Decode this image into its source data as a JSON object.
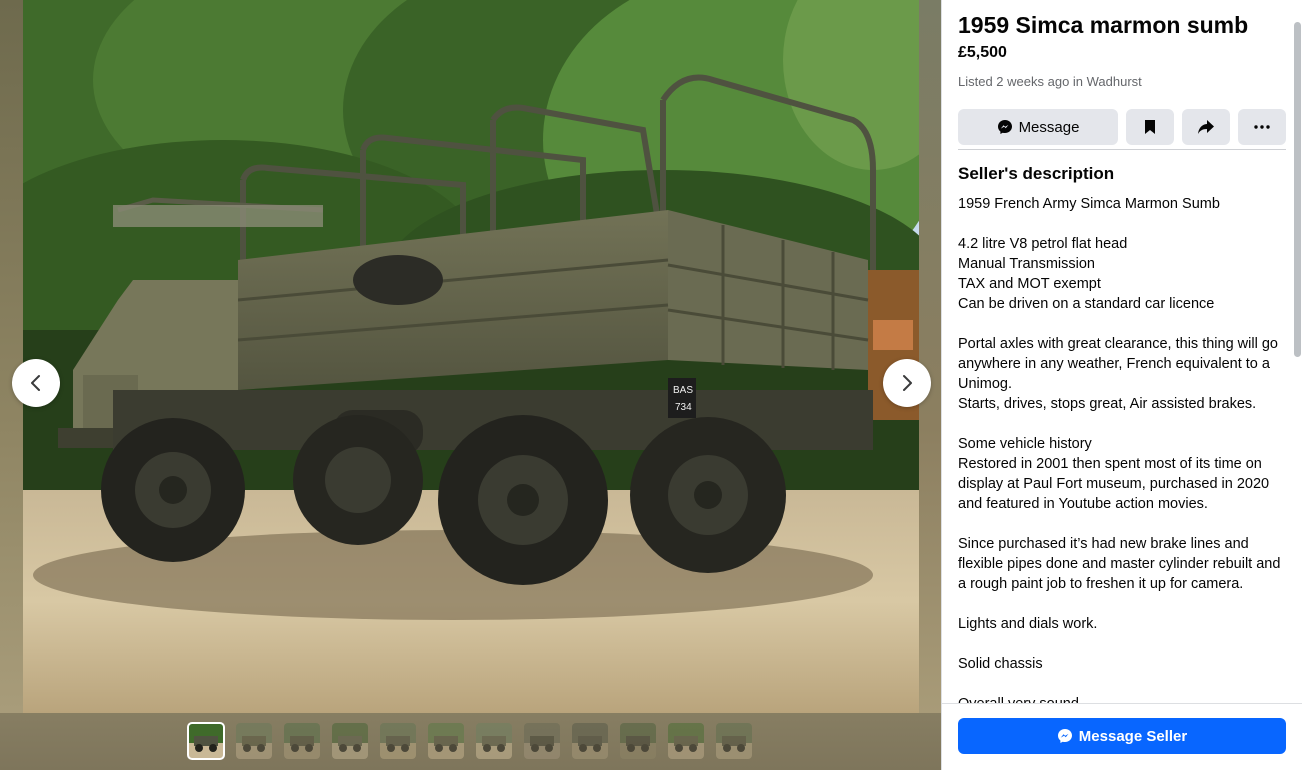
{
  "listing": {
    "title": "1959 Simca marmon sumb",
    "price": "£5,500",
    "listed": "Listed 2 weeks ago in Wadhurst"
  },
  "actions": {
    "message_label": "Message",
    "save_icon": "bookmark-icon",
    "share_icon": "share-icon",
    "more_icon": "more-icon"
  },
  "description": {
    "heading": "Seller's description",
    "paragraphs": [
      "1959 French Army Simca Marmon Sumb",
      "4.2 litre V8 petrol flat head\nManual Transmission\nTAX and MOT exempt\nCan be driven on a standard car licence",
      "Portal axles with great clearance, this thing will go anywhere in any weather,  French equivalent to a Unimog.\nStarts, drives, stops great, Air assisted brakes.",
      "Some vehicle history\nRestored in 2001 then spent most of its time on display at Paul Fort museum, purchased in 2020 and featured in Youtube action movies.",
      "Since purchased it’s had new brake lines and flexible pipes done and master cylinder rebuilt and a rough paint job to freshen it up for camera.",
      "Lights and dials work.",
      "Solid chassis",
      "Overall very sound."
    ]
  },
  "footer": {
    "message_seller_label": "Message Seller"
  },
  "gallery": {
    "photo_plate": "BAS 734",
    "thumbnail_count": 12,
    "active_index": 0
  },
  "colors": {
    "accent": "#0866ff",
    "button_bg": "#e4e6eb",
    "text_primary": "#050505",
    "text_secondary": "#65676b"
  }
}
